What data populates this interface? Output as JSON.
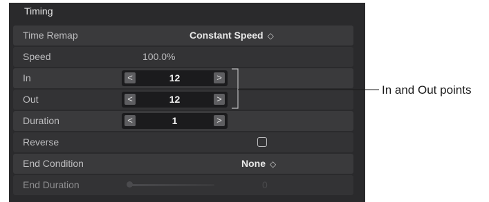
{
  "panel": {
    "section_title": "Timing",
    "rows": {
      "time_remap": {
        "label": "Time Remap",
        "value": "Constant Speed",
        "updown": "◇"
      },
      "speed": {
        "label": "Speed",
        "value": "100.0%"
      },
      "in": {
        "label": "In",
        "value": "12",
        "left_arrow": "<",
        "right_arrow": ">"
      },
      "out": {
        "label": "Out",
        "value": "12",
        "left_arrow": "<",
        "right_arrow": ">"
      },
      "duration": {
        "label": "Duration",
        "value": "1",
        "left_arrow": "<",
        "right_arrow": ">"
      },
      "reverse": {
        "label": "Reverse",
        "checked": false
      },
      "end_condition": {
        "label": "End Condition",
        "value": "None",
        "updown": "◇"
      },
      "end_duration": {
        "label": "End Duration",
        "value": "0",
        "slider_fraction": 0.0
      }
    }
  },
  "callout": {
    "text": "In and Out points"
  },
  "colors": {
    "panel_bg": "#2a2a2c",
    "row_bg": "#3a3a3c",
    "stepper_bg": "#1b1b1d"
  }
}
